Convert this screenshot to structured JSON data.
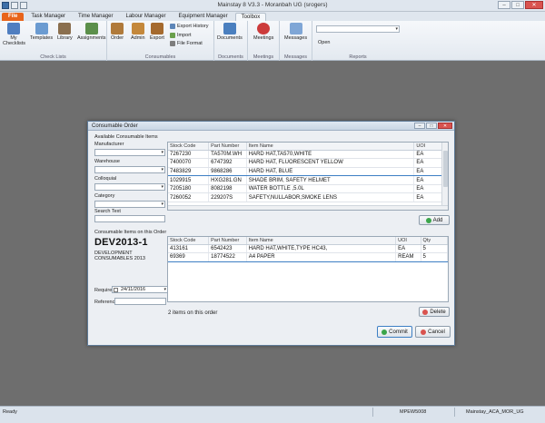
{
  "window": {
    "title": "Mainstay  8 V3.3 - Moranbah UG (srogers)"
  },
  "ribbon_tabs": [
    "File",
    "Task Manager",
    "Time Manager",
    "Labour Manager",
    "Equipment Manager",
    "Toolbox"
  ],
  "ribbon": {
    "checklists": {
      "label": "Check Lists",
      "items": [
        "My Checklists",
        "Templates",
        "Library",
        "Assignments"
      ]
    },
    "consumables": {
      "label": "Consumables",
      "items": [
        "Order",
        "Admin",
        "Export"
      ],
      "small_items": [
        "Export History",
        "Import",
        "File Format"
      ]
    },
    "documents": {
      "label": "Documents",
      "button": "Documents"
    },
    "meetings": {
      "label": "Meetings",
      "button": "Meetings"
    },
    "messages": {
      "label": "Messages",
      "button": "Messages"
    },
    "reports": {
      "label": "Reports",
      "button": "Open"
    }
  },
  "dialog": {
    "title": "Consumable Order",
    "available_label": "Available Consumable Items",
    "manufacturer_label": "Manufacturer",
    "warehouse_label": "Warehouse",
    "colloquial_label": "Colloquial",
    "category_label": "Category",
    "search_label": "Search Text",
    "on_order_label": "Consumable Items on this Order",
    "order_code": "DEV2013-1",
    "order_desc_line1": "DEVELOPMENT",
    "order_desc_line2": "CONSUMABLES 2013",
    "required_label": "Required",
    "required_date": "24/11/2016",
    "reference_label": "Reference",
    "items_count": "2 items on this order",
    "available_grid": {
      "headers": [
        "Stock Code",
        "Part Number",
        "Item Name",
        "UOI"
      ],
      "rows": [
        [
          "7267230",
          "TA570M.WH",
          "HARD HAT,TA570,WHITE",
          "EA"
        ],
        [
          "7400070",
          "6747392",
          "HARD HAT, FLUORESCENT YELLOW",
          "EA"
        ],
        [
          "7483829",
          "9868286",
          "HARD HAT, BLUE",
          "EA"
        ],
        [
          "1029915",
          "HXG281.GN",
          "SHADE BRIM, SAFETY HELMET",
          "EA"
        ],
        [
          "7205180",
          "8082198",
          "WATER BOTTLE ,5.0L",
          "EA"
        ],
        [
          "7260052",
          "229207S",
          "SAFETY,NULLABOR,SMOKE LENS",
          "EA"
        ]
      ]
    },
    "order_grid": {
      "headers": [
        "Stock Code",
        "Part Number",
        "Item Name",
        "UOI",
        "Qty"
      ],
      "rows": [
        [
          "413161",
          "6542423",
          "HARD HAT,WHITE,TYPE HC43,",
          "EA",
          "5"
        ],
        [
          "69369",
          "18774522",
          "A4 PAPER",
          "REAM",
          "5"
        ]
      ]
    },
    "add_button": "Add",
    "delete_button": "Delete",
    "commit_button": "Commit",
    "cancel_button": "Cancel"
  },
  "statusbar": {
    "left": "Ready",
    "middle": "MPEW5008",
    "right": "Mainstay_ACA_MOR_UG"
  },
  "colors": {
    "file_tab": "#e8641b",
    "add_icon": "#3aa54a",
    "delete_icon": "#d9534f",
    "commit_icon": "#3aa54a",
    "cancel_icon": "#d9534f"
  }
}
